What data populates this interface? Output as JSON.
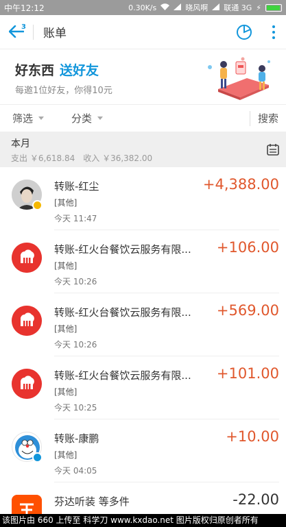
{
  "status": {
    "time": "中午12:12",
    "speed": "0.30K/s",
    "carrier1": "晓风啊",
    "carrier2": "联通 3G"
  },
  "appbar": {
    "back_badge": "3",
    "title": "账单",
    "icons": [
      "back-arrow-icon",
      "pie-chart-icon",
      "more-icon"
    ]
  },
  "banner": {
    "title": "好东西",
    "title_highlight": "送好友",
    "subtitle": "每邀1位好友，你得10元"
  },
  "filter": {
    "filter_label": "筛选",
    "category_label": "分类",
    "search_label": "搜索"
  },
  "month": {
    "label": "本月",
    "expense": "支出 ￥6,618.84",
    "income": "收入 ￥36,382.00"
  },
  "transactions": [
    {
      "name": "转账-红尘",
      "category": "[其他]",
      "time": "今天  11:47",
      "amount": "+4,388.00"
    },
    {
      "name": "转账-红火台餐饮云服务有限...",
      "category": "[其他]",
      "time": "今天  10:26",
      "amount": "+106.00"
    },
    {
      "name": "转账-红火台餐饮云服务有限...",
      "category": "[其他]",
      "time": "今天  10:26",
      "amount": "+569.00"
    },
    {
      "name": "转账-红火台餐饮云服务有限...",
      "category": "[其他]",
      "time": "今天  10:25",
      "amount": "+101.00"
    },
    {
      "name": "转账-康鹏",
      "category": "[其他]",
      "time": "今天  04:05",
      "amount": "+10.00"
    },
    {
      "name": "芬达听装 等多件",
      "category": "",
      "time": "",
      "amount": "-22.00"
    }
  ],
  "watermark": "该图片由 660 上传至 科学刀 www.kxdao.net 图片版权归原创者所有",
  "colors": {
    "accent": "#1296db",
    "income": "#e0572c",
    "restaurant_red": "#e8332e",
    "taobao_orange": "#ff5000"
  }
}
